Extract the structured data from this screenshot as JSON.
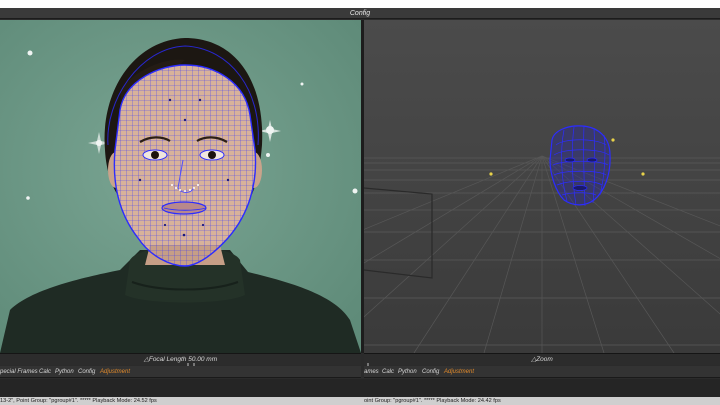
{
  "window": {
    "title": "Config"
  },
  "left_viewport": {
    "focal_length_label": "△Focal Length 50.00 mm"
  },
  "right_viewport": {
    "zoom_label": "△Zoom"
  },
  "left_tabs": [
    {
      "label": "pecial Frames",
      "active": false
    },
    {
      "label": "Calc",
      "active": false
    },
    {
      "label": "Python",
      "active": false
    },
    {
      "label": "Config",
      "active": false
    },
    {
      "label": "Adjustment",
      "active": true
    }
  ],
  "right_tabs": [
    {
      "label": "ames",
      "active": false
    },
    {
      "label": "Calc",
      "active": false
    },
    {
      "label": "Python",
      "active": false
    },
    {
      "label": "Config",
      "active": false
    },
    {
      "label": "Adjustment",
      "active": true
    }
  ],
  "status": {
    "left": "13-2\", Point Group: \"pgroup#1\". ***** Playback Mode: 24.52 fps",
    "right": "oint Group: \"pgroup#1\". ***** Playback Mode: 24.42 fps"
  },
  "colors": {
    "mesh": "#2c2cff",
    "accent_tab": "#e08a2c",
    "backdrop": "#6e9a88"
  }
}
